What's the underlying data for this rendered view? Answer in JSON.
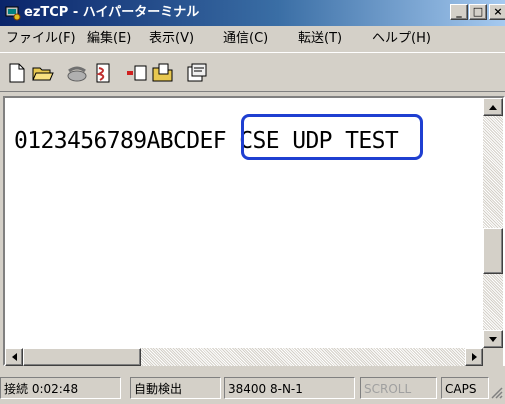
{
  "window": {
    "title": "ezTCP - ハイパーターミナル",
    "controls": {
      "minimize": "_",
      "maximize": "□",
      "close": "×"
    }
  },
  "menu": [
    {
      "label": "ファイル(F)"
    },
    {
      "label": "編集(E)"
    },
    {
      "label": "表示(V)"
    },
    {
      "label": "通信(C)"
    },
    {
      "label": "転送(T)"
    },
    {
      "label": "ヘルプ(H)"
    }
  ],
  "toolbar": {
    "buttons": [
      {
        "icon": "new-file-icon"
      },
      {
        "icon": "open-folder-icon"
      },
      {
        "icon": "call-icon"
      },
      {
        "icon": "disconnect-icon"
      },
      {
        "icon": "send-icon"
      },
      {
        "icon": "receive-icon"
      },
      {
        "icon": "properties-icon"
      }
    ]
  },
  "terminal": {
    "line": "0123456789ABCDEF CSE UDP TEST",
    "highlighted_text": "CSE UDP TEST",
    "highlight_color": "#1f3fd1"
  },
  "status": {
    "connection": "接続 0:02:48",
    "detect": "自動検出",
    "settings": "38400 8-N-1",
    "scroll": "SCROLL",
    "caps": "CAPS"
  }
}
